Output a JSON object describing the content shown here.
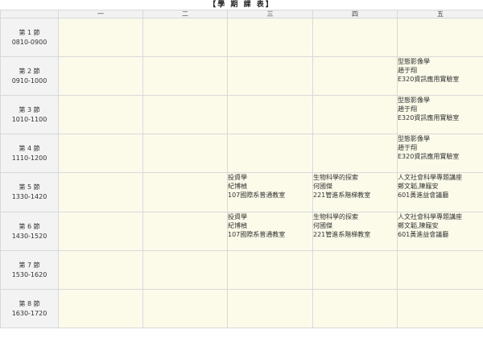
{
  "title": "【學 期 課 表】",
  "days": [
    "一",
    "二",
    "三",
    "四",
    "五"
  ],
  "periods": [
    {
      "label": "第 1 節",
      "time": "0810-0900",
      "cells": [
        null,
        null,
        null,
        null,
        null
      ]
    },
    {
      "label": "第 2 節",
      "time": "0910-1000",
      "cells": [
        null,
        null,
        null,
        null,
        {
          "course": "型態影像學",
          "teacher": "趙于翔",
          "room": "E320資訊應用實驗室"
        }
      ]
    },
    {
      "label": "第 3 節",
      "time": "1010-1100",
      "cells": [
        null,
        null,
        null,
        null,
        {
          "course": "型態影像學",
          "teacher": "趙于翔",
          "room": "E320資訊應用實驗室"
        }
      ]
    },
    {
      "label": "第 4 節",
      "time": "1110-1200",
      "cells": [
        null,
        null,
        null,
        null,
        {
          "course": "型態影像學",
          "teacher": "趙于翔",
          "room": "E320資訊應用實驗室"
        }
      ]
    },
    {
      "label": "第 5 節",
      "time": "1330-1420",
      "cells": [
        null,
        null,
        {
          "course": "投資學",
          "teacher": "紀博楨",
          "room": "107國際系普通教室"
        },
        {
          "course": "生物科學的探索",
          "teacher": "何國傑",
          "room": "221管進系階梯教室"
        },
        {
          "course": "人文社會科學專題講座",
          "teacher": "鄭文韜,陳寵安",
          "room": "601黃進益會議廳"
        }
      ]
    },
    {
      "label": "第 6 節",
      "time": "1430-1520",
      "cells": [
        null,
        null,
        {
          "course": "投資學",
          "teacher": "紀博楨",
          "room": "107國際系普通教室"
        },
        {
          "course": "生物科學的探索",
          "teacher": "何國傑",
          "room": "221管進系階梯教室"
        },
        {
          "course": "人文社會科學專題講座",
          "teacher": "鄭文韜,陳寵安",
          "room": "601黃進益會議廳"
        }
      ]
    },
    {
      "label": "第 7 節",
      "time": "1530-1620",
      "cells": [
        null,
        null,
        null,
        null,
        null
      ]
    },
    {
      "label": "第 8 節",
      "time": "1630-1720",
      "cells": [
        null,
        null,
        null,
        null,
        null
      ]
    }
  ]
}
